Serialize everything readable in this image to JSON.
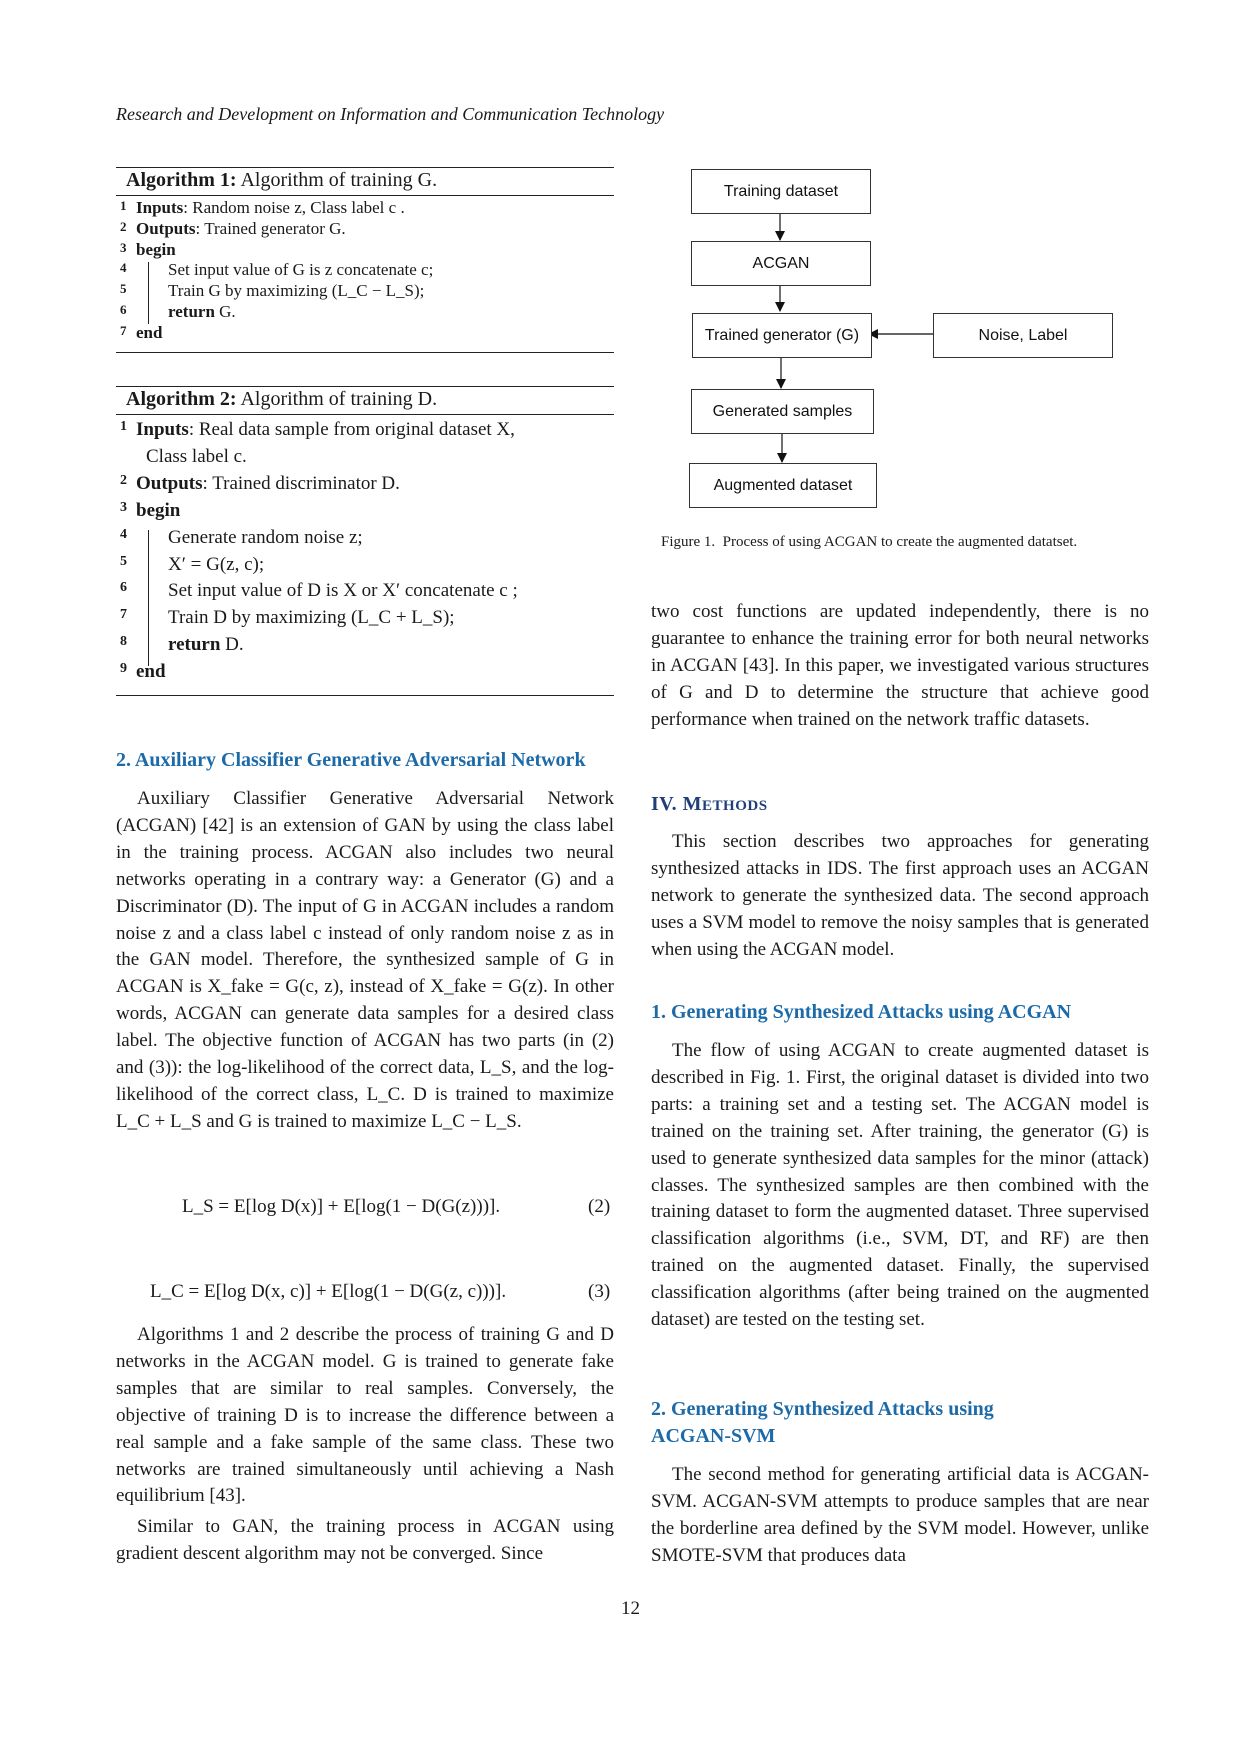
{
  "header": {
    "running_title": "Research and Development on Information and Communication Technology"
  },
  "algorithm1": {
    "label": "Algorithm 1:",
    "title": "Algorithm of training G.",
    "lines": [
      {
        "num": "1",
        "kw": "Inputs",
        "text": ": Random noise z, Class label c ."
      },
      {
        "num": "2",
        "kw": "Outputs",
        "text": ": Trained generator G."
      },
      {
        "num": "3",
        "kw": "begin",
        "text": ""
      },
      {
        "num": "4",
        "kw": "",
        "text": "Set input value of G is z concatenate c;"
      },
      {
        "num": "5",
        "kw": "",
        "text": "Train G by maximizing (L_C − L_S);"
      },
      {
        "num": "6",
        "kw": "return",
        "text": " G."
      },
      {
        "num": "7",
        "kw": "end",
        "text": ""
      }
    ]
  },
  "algorithm2": {
    "label": "Algorithm 2:",
    "title": "Algorithm of training D.",
    "lines": [
      {
        "num": "1",
        "kw": "Inputs",
        "text": ": Real data sample from original dataset X,"
      },
      {
        "num": "",
        "kw": "",
        "text": "Class label c."
      },
      {
        "num": "2",
        "kw": "Outputs",
        "text": ": Trained discriminator D."
      },
      {
        "num": "3",
        "kw": "begin",
        "text": ""
      },
      {
        "num": "4",
        "kw": "",
        "text": "Generate random noise z;"
      },
      {
        "num": "5",
        "kw": "",
        "text": "X′ = G(z, c);"
      },
      {
        "num": "6",
        "kw": "",
        "text": "Set input value of D is X or X′ concatenate c ;"
      },
      {
        "num": "7",
        "kw": "",
        "text": "Train D by maximizing (L_C + L_S);"
      },
      {
        "num": "8",
        "kw": "return",
        "text": " D."
      },
      {
        "num": "9",
        "kw": "end",
        "text": ""
      }
    ]
  },
  "section_acgan": {
    "heading": "2. Auxiliary Classifier Generative Adversarial Network",
    "paragraph1": "Auxiliary Classifier Generative Adversarial Network (ACGAN) [42] is an extension of GAN by using the class label in the training process. ACGAN also includes two neural networks operating in a contrary way: a Generator (G) and a Discriminator (D). The input of G in ACGAN includes a random noise z and a class label c instead of only random noise z as in the GAN model. Therefore, the synthesized sample of G in ACGAN is X_fake = G(c, z), instead of X_fake = G(z). In other words, ACGAN can generate data samples for a desired class label. The objective function of ACGAN has two parts (in (2) and (3)): the log-likelihood of the correct data, L_S, and the log-likelihood of the correct class, L_C. D is trained to maximize L_C + L_S and G is trained to maximize L_C − L_S.",
    "equation2": {
      "text": "L_S = E[log D(x)] + E[log(1 − D(G(z)))].",
      "number": "(2)"
    },
    "equation3": {
      "text": "L_C = E[log D(x, c)] + E[log(1 − D(G(z, c)))].",
      "number": "(3)"
    },
    "paragraph2": "Algorithms 1 and 2 describe the process of training G and D networks in the ACGAN model. G is trained to generate fake samples that are similar to real samples. Conversely, the objective of training D is to increase the difference between a real sample and a fake sample of the same class. These two networks are trained simultaneously until achieving a Nash equilibrium [43].",
    "paragraph3_start": "Similar to GAN, the training process in ACGAN using gradient descent algorithm may not be converged. Since"
  },
  "figure1": {
    "boxes": [
      "Training dataset",
      "ACGAN",
      "Trained generator (G)",
      "Generated samples",
      "Augmented dataset"
    ],
    "side_box": "Noise, Label",
    "caption": "Figure 1.  Process of using ACGAN to create the augmented datatset."
  },
  "right_column": {
    "continuation": "two cost functions are updated independently, there is no guarantee to enhance the training error for both neural networks in ACGAN [43]. In this paper, we investigated various structures of G and D to determine the structure that achieve good performance when trained on the network traffic datasets.",
    "section_methods": {
      "numeral": "IV.",
      "title_first": "M",
      "title_rest": "ETHODS"
    },
    "methods_intro": "This section describes two approaches for generating synthesized attacks in IDS. The first approach uses an ACGAN network to generate the synthesized data. The second approach uses a SVM model to remove the noisy samples that is generated when using the ACGAN model.",
    "sub1_heading": "1. Generating Synthesized Attacks using ACGAN",
    "sub1_text": "The flow of using ACGAN to create augmented dataset is described in Fig. 1. First, the original dataset is divided into two parts: a training set and a testing set. The ACGAN model is trained on the training set. After training, the generator (G) is used to generate synthesized data samples for the minor (attack) classes. The synthesized samples are then combined with the training dataset to form the augmented dataset. Three supervised classification algorithms (i.e., SVM, DT, and RF) are then trained on the augmented dataset. Finally, the supervised classification algorithms (after being trained on the augmented dataset) are tested on the testing set.",
    "sub2_heading_line1": "2. Generating Synthesized Attacks using",
    "sub2_heading_line2": "ACGAN-SVM",
    "sub2_text": "The second method for generating artificial data is ACGAN-SVM. ACGAN-SVM attempts to produce samples that are near the borderline area defined by the SVM model. However, unlike SMOTE-SVM that produces data"
  },
  "page_number": "12",
  "colors": {
    "heading_blue": "#1c6aa8",
    "section_navy": "#1f3f7a"
  }
}
